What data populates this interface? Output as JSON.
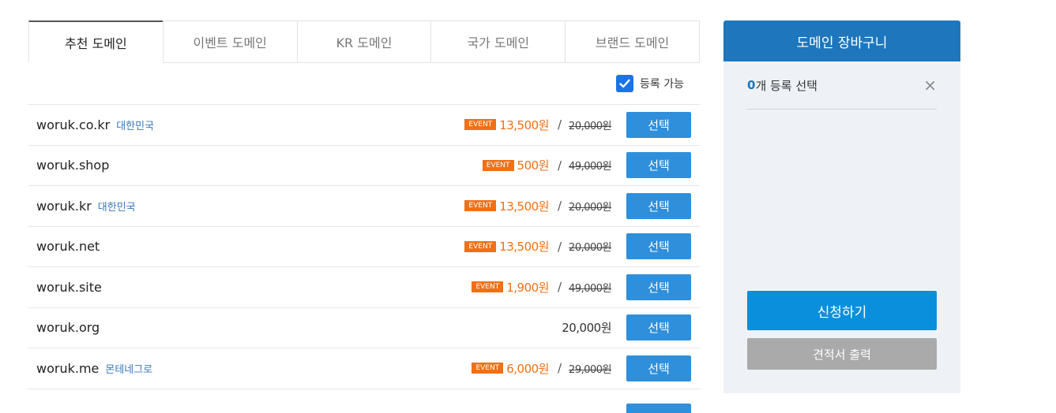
{
  "tabs": [
    "추천 도메인",
    "이벤트 도메인",
    "KR 도메인",
    "국가 도메인",
    "브랜드 도메인"
  ],
  "filter": {
    "label": "등록 가능",
    "checked": true
  },
  "rows": [
    {
      "domain": "woruk.co.kr",
      "country": "대한민국",
      "badge": "EVENT",
      "price": "13,500원",
      "slash": "/",
      "original": "20,000원",
      "button": "선택"
    },
    {
      "domain": "woruk.shop",
      "country": "",
      "badge": "EVENT",
      "price": "500원",
      "slash": "/",
      "original": "49,000원",
      "button": "선택"
    },
    {
      "domain": "woruk.kr",
      "country": "대한민국",
      "badge": "EVENT",
      "price": "13,500원",
      "slash": "/",
      "original": "20,000원",
      "button": "선택"
    },
    {
      "domain": "woruk.net",
      "country": "",
      "badge": "EVENT",
      "price": "13,500원",
      "slash": "/",
      "original": "20,000원",
      "button": "선택"
    },
    {
      "domain": "woruk.site",
      "country": "",
      "badge": "EVENT",
      "price": "1,900원",
      "slash": "/",
      "original": "49,000원",
      "button": "선택"
    },
    {
      "domain": "woruk.org",
      "country": "",
      "badge": "",
      "price": "",
      "slash": "",
      "original": "",
      "normal_price": "20,000원",
      "button": "선택"
    },
    {
      "domain": "woruk.me",
      "country": "몬테네그로",
      "badge": "EVENT",
      "price": "6,000원",
      "slash": "/",
      "original": "29,000원",
      "button": "선택"
    }
  ],
  "cart": {
    "title": "도메인 장바구니",
    "count": "0",
    "count_text": "개 등록 선택",
    "close": "×",
    "apply": "신청하기",
    "quote": "견적서 출력"
  },
  "colors": {
    "accent": "#1e77bd",
    "event": "#f07016",
    "button": "#2f8fdb"
  },
  "icons": {
    "checkbox": "checkbox-checked-icon",
    "close": "close-icon"
  }
}
